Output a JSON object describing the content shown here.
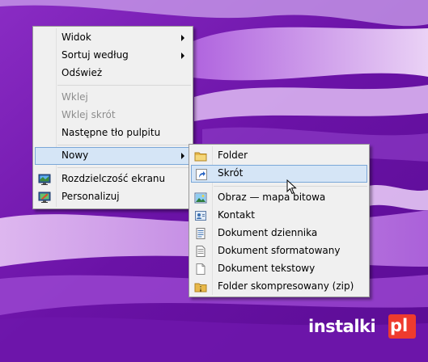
{
  "context_menu": {
    "items": [
      {
        "label": "Widok",
        "submenu": true
      },
      {
        "label": "Sortuj według",
        "submenu": true
      },
      {
        "label": "Odśwież"
      },
      {
        "label": "Wklej",
        "disabled": true
      },
      {
        "label": "Wklej skrót",
        "disabled": true
      },
      {
        "label": "Następne tło pulpitu"
      },
      {
        "label": "Nowy",
        "submenu": true,
        "highlighted": true
      },
      {
        "label": "Rozdzielczość ekranu",
        "icon": "display-settings-icon"
      },
      {
        "label": "Personalizuj",
        "icon": "personalize-icon"
      }
    ]
  },
  "new_submenu": {
    "items": [
      {
        "label": "Folder",
        "icon": "folder-icon"
      },
      {
        "label": "Skrót",
        "icon": "shortcut-icon",
        "highlighted": true
      },
      {
        "label": "Obraz — mapa bitowa",
        "icon": "bitmap-image-icon"
      },
      {
        "label": "Kontakt",
        "icon": "contact-icon"
      },
      {
        "label": "Dokument dziennika",
        "icon": "journal-document-icon"
      },
      {
        "label": "Dokument sformatowany",
        "icon": "rich-text-document-icon"
      },
      {
        "label": "Dokument tekstowy",
        "icon": "text-document-icon"
      },
      {
        "label": "Folder skompresowany (zip)",
        "icon": "zip-folder-icon"
      }
    ]
  },
  "watermark": {
    "text": "instalki",
    "suffix": "pl"
  },
  "colors": {
    "highlight_bg": "#d5e5f6",
    "highlight_border": "#7aa7d8",
    "menu_bg": "#f0f0f0",
    "logo_red": "#ee3b2e"
  }
}
